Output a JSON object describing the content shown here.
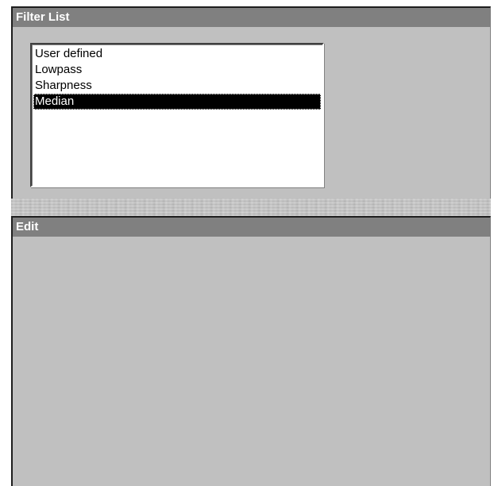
{
  "filter_list": {
    "title": "Filter List",
    "items": [
      {
        "label": "User defined",
        "selected": false
      },
      {
        "label": "Lowpass",
        "selected": false
      },
      {
        "label": "Sharpness",
        "selected": false
      },
      {
        "label": "Median",
        "selected": true
      }
    ]
  },
  "edit": {
    "title": "Edit"
  },
  "colors": {
    "panel_background": "#c0c0c0",
    "title_bar": "#808080",
    "title_text": "#ffffff",
    "selection_background": "#000000",
    "selection_text": "#ffffff"
  }
}
